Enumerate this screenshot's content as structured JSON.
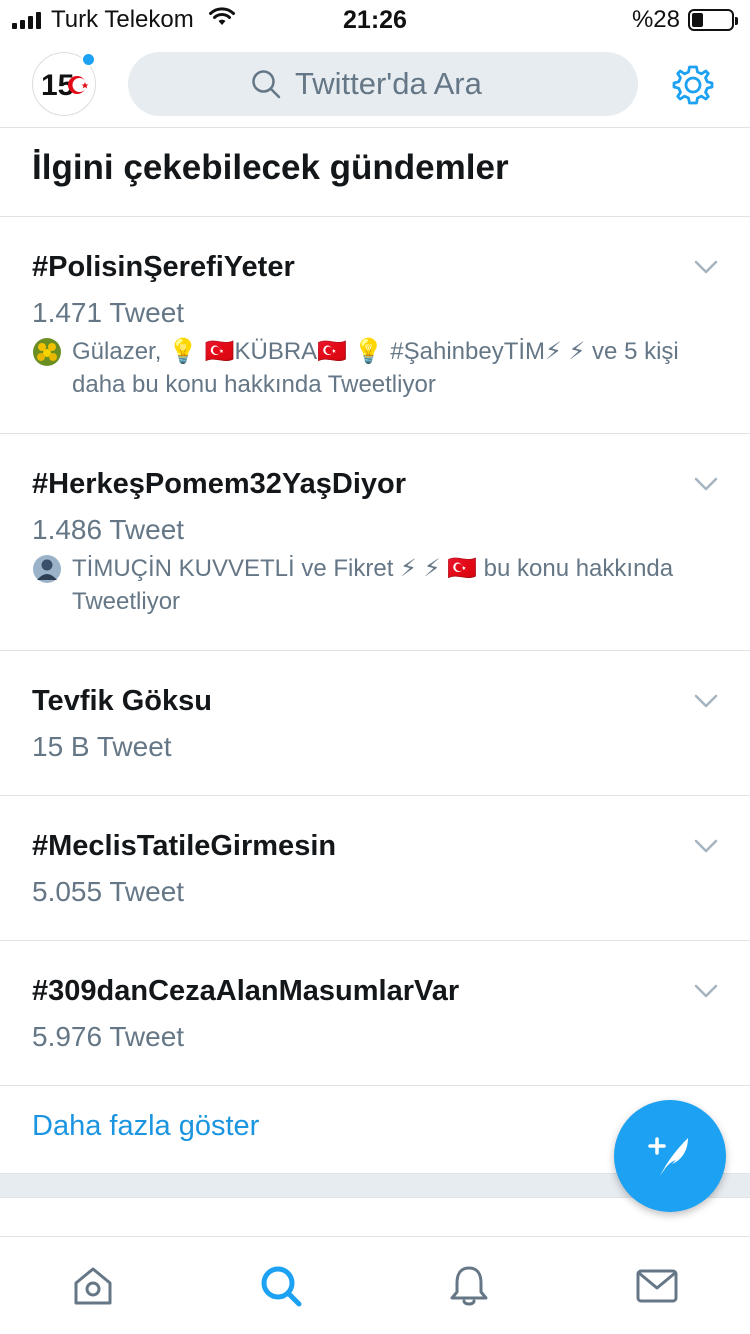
{
  "status_bar": {
    "carrier": "Turk Telekom",
    "time": "21:26",
    "battery": "%28",
    "battery_level": 0.28
  },
  "header": {
    "search_placeholder": "Twitter'da Ara",
    "avatar_label": "15",
    "icons": [
      "avatar-logo",
      "search-icon",
      "gear-icon"
    ]
  },
  "section": {
    "title": "İlgini çekebilecek gündemler"
  },
  "trends": [
    {
      "name": "#PolisinŞerefiYeter",
      "count": "1.471 Tweet",
      "context": "Gülazer, 💡 🇹🇷KÜBRA🇹🇷 💡 #ŞahinbeyTİM⚡ ⚡  ve 5 kişi daha bu konu hakkında Tweetliyor",
      "context_icon": "flower-avatar"
    },
    {
      "name": "#HerkeşPomem32YaşDiyor",
      "count": "1.486 Tweet",
      "context": "TİMUÇİN KUVVETLİ ve Fikret ⚡ ⚡ 🇹🇷  bu konu hakkında Tweetliyor",
      "context_icon": "user-avatar"
    },
    {
      "name": "Tevfik Göksu",
      "count": "15 B Tweet"
    },
    {
      "name": "#MeclisTatileGirmesin",
      "count": "5.055 Tweet"
    },
    {
      "name": "#309danCezaAlanMasumlarVar",
      "count": "5.976 Tweet"
    }
  ],
  "show_more": "Daha fazla göster",
  "colors": {
    "accent": "#1da1f2",
    "link": "#1b95e0",
    "secondary_text": "#657786",
    "divider": "#dfe3e6"
  },
  "tabbar": {
    "icons": [
      "home-icon",
      "search-icon",
      "notifications-icon",
      "messages-icon"
    ],
    "active": "search-icon"
  }
}
